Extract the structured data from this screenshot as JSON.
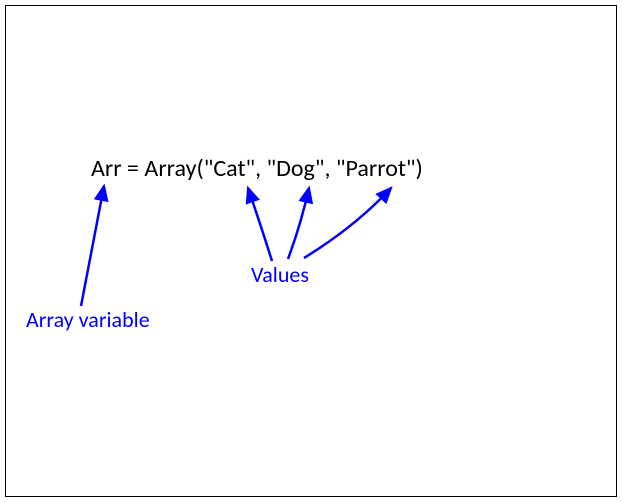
{
  "code": {
    "full_line": "Arr = Array(\"Cat\", \"Dog\", \"Parrot\")",
    "variable_name": "Arr",
    "function_name": "Array",
    "values": [
      "Cat",
      "Dog",
      "Parrot"
    ]
  },
  "annotations": {
    "variable_label": "Array variable",
    "values_label": "Values"
  },
  "colors": {
    "text": "#000000",
    "annotation": "#0000ff",
    "arrow": "#0000ff"
  }
}
